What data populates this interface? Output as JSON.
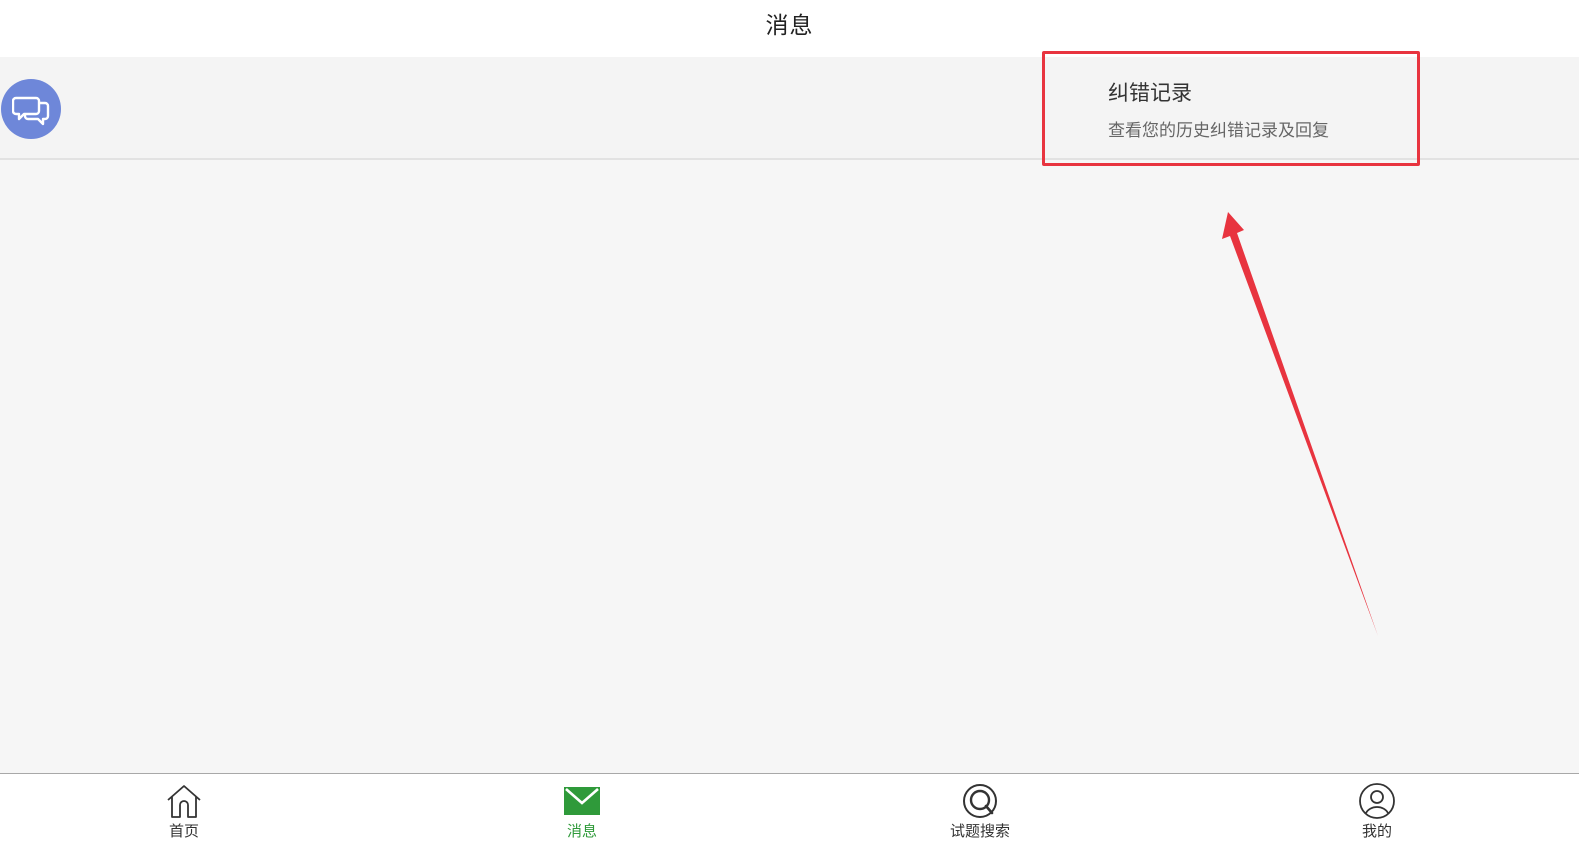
{
  "header": {
    "title": "消息"
  },
  "message_item": {
    "title": "纠错记录",
    "subtitle": "查看您的历史纠错记录及回复",
    "avatar_icon": "chat-bubbles-icon",
    "avatar_color": "#6e87d9"
  },
  "annotation": {
    "highlight_color": "#e8343f"
  },
  "tabbar": {
    "active_color": "#2f9a3a",
    "tabs": [
      {
        "label": "首页",
        "icon": "home-icon",
        "active": false
      },
      {
        "label": "消息",
        "icon": "envelope-icon",
        "active": true
      },
      {
        "label": "试题搜索",
        "icon": "search-icon",
        "active": false
      },
      {
        "label": "我的",
        "icon": "user-icon",
        "active": false
      }
    ]
  }
}
